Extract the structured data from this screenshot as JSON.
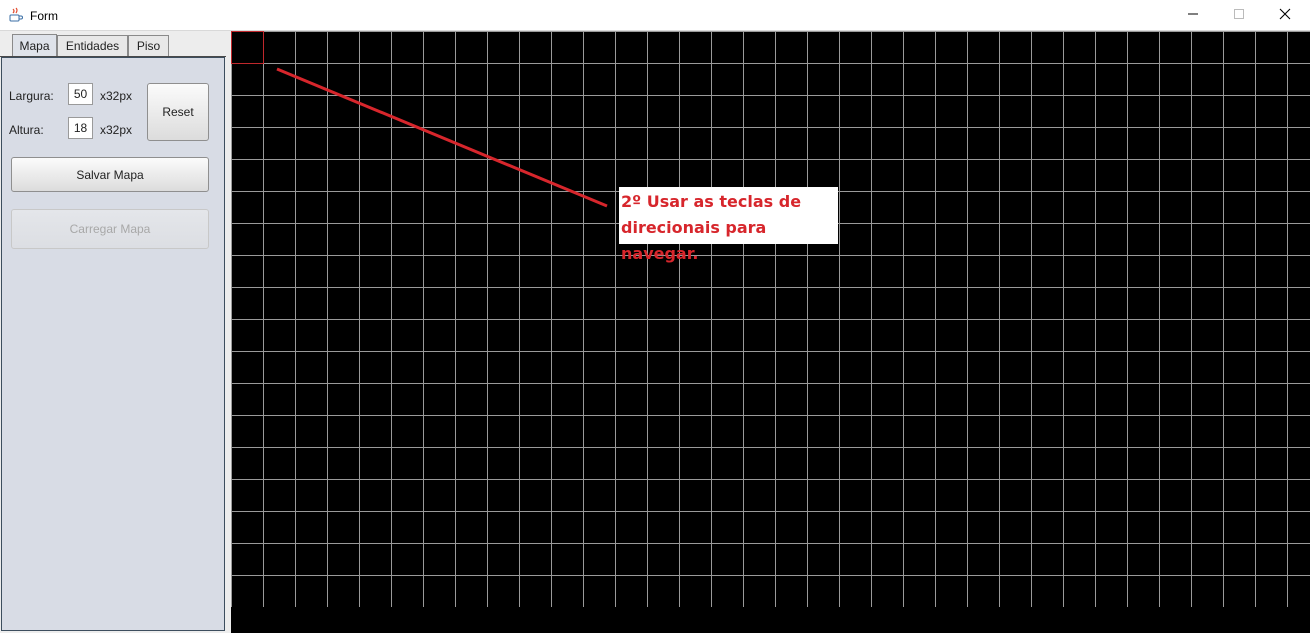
{
  "window": {
    "title": "Form",
    "app_icon": "java-coffee-icon",
    "controls": [
      "minimize-icon",
      "maximize-icon",
      "close-icon"
    ]
  },
  "tabs": [
    {
      "label": "Mapa",
      "active": true
    },
    {
      "label": "Entidades",
      "active": false
    },
    {
      "label": "Piso",
      "active": false
    }
  ],
  "form": {
    "largura_label": "Largura:",
    "largura_value": "50",
    "largura_unit": "x32px",
    "altura_label": "Altura:",
    "altura_value": "18",
    "altura_unit": "x32px",
    "reset_label": "Reset",
    "save_label": "Salvar Mapa",
    "load_label": "Carregar Mapa"
  },
  "map_grid": {
    "columns_visible": 34,
    "rows_visible": 18,
    "grid_color": "#9a9a9a",
    "background_color": "#000000",
    "cursor_color": "#c0282c"
  },
  "annotation": {
    "text": "2º Usar as teclas de\ndirecionais para navegar.",
    "color": "#d7262c"
  }
}
